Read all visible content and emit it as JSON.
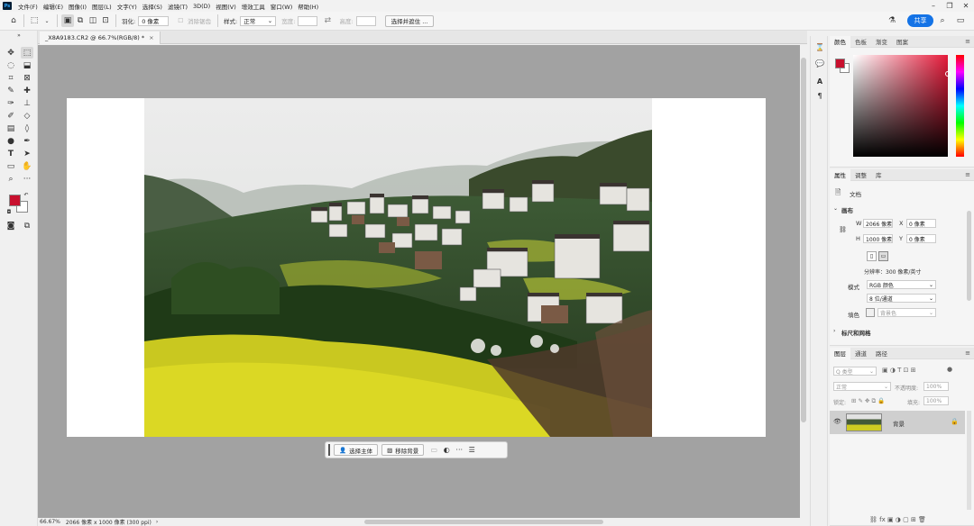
{
  "app": {
    "logo": "Ps",
    "menus": [
      "文件(F)",
      "编辑(E)",
      "图像(I)",
      "图层(L)",
      "文字(Y)",
      "选择(S)",
      "滤镜(T)",
      "3D(D)",
      "视图(V)",
      "增效工具",
      "窗口(W)",
      "帮助(H)"
    ]
  },
  "options": {
    "feather_label": "羽化:",
    "feather_value": "0 像素",
    "antialias_label": "消除锯齿",
    "style_label": "样式:",
    "style_value": "正常",
    "width_label": "宽度:",
    "height_label": "高度:",
    "select_mask_button": "选择并遮住 ...",
    "share_button": "共享"
  },
  "document": {
    "tab_title": "_X8A9183.CR2 @ 66.7%(RGB/8) *",
    "tab_close": "×"
  },
  "context_bar": {
    "select_subject": "选择主体",
    "remove_background": "移除背景",
    "more": "···"
  },
  "status": {
    "zoom": "66.67%",
    "doc_info": "2066 像素 x 1000 像素 (300 ppi)",
    "arrow": "›"
  },
  "color_panel": {
    "tabs": [
      "颜色",
      "色板",
      "渐变",
      "图案"
    ],
    "foreground": "#c8102e",
    "background": "#ffffff"
  },
  "properties_panel": {
    "tabs": [
      "属性",
      "调整",
      "库"
    ],
    "doc_label": "文档",
    "canvas_section": "画布",
    "w_label": "W",
    "w_value": "2066 像素",
    "h_label": "H",
    "h_value": "1000 像素",
    "x_label": "X",
    "x_value": "0 像素",
    "y_label": "Y",
    "y_value": "0 像素",
    "resolution": "分辨率：300 像素/英寸",
    "mode_label": "模式",
    "mode_value": "RGB 颜色",
    "depth_value": "8 位/通道",
    "fill_label": "填色",
    "fill_value": "背景色",
    "rulers_section": "标尺和网格"
  },
  "layers_panel": {
    "tabs": [
      "图层",
      "通道",
      "路径"
    ],
    "filter_value": "Q 类型",
    "blend_value": "正常",
    "opacity_label": "不透明度:",
    "opacity_value": "100%",
    "lock_label": "锁定:",
    "fill_label": "填充:",
    "fill_value": "100%",
    "layer_name": "背景"
  }
}
